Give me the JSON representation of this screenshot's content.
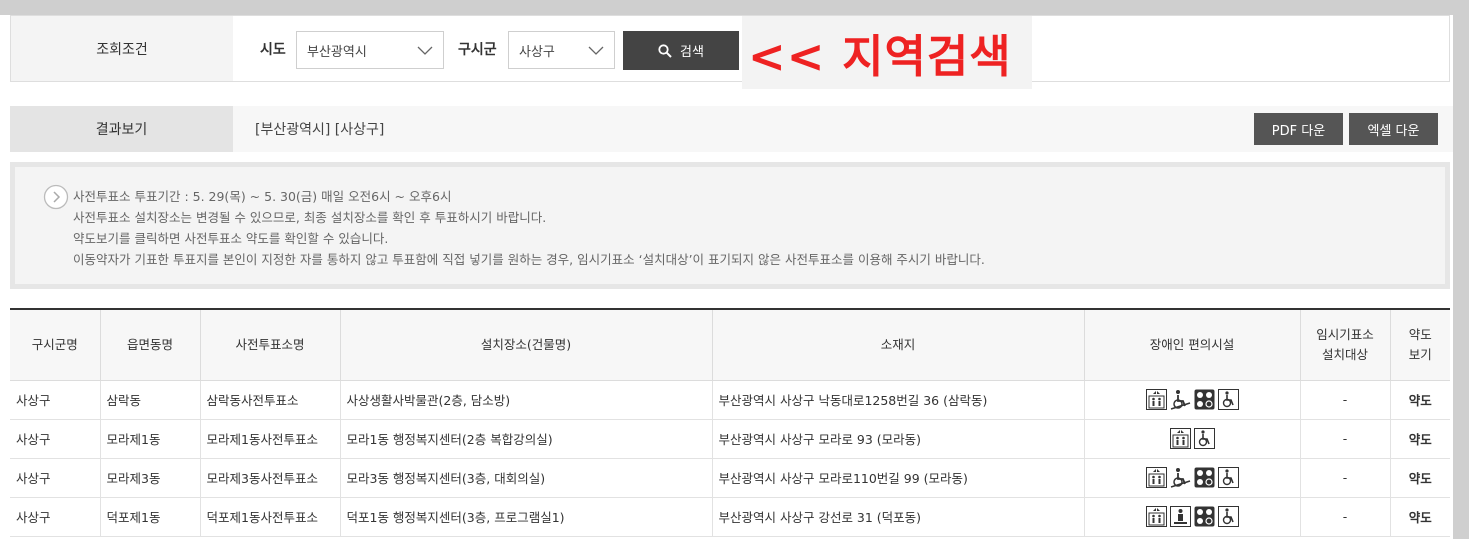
{
  "search": {
    "label": "조회조건",
    "sido_label": "시도",
    "sido_value": "부산광역시",
    "sigungu_label": "구시군",
    "sigungu_value": "사상구",
    "button_label": "검색",
    "annotation": "<< 지역검색"
  },
  "result": {
    "label": "결과보기",
    "text": "[부산광역시] [사상구]",
    "pdf_label": "PDF 다운",
    "excel_label": "엑셀 다운"
  },
  "notice": {
    "lines": [
      "사전투표소 투표기간 : 5. 29(목) ~ 5. 30(금) 매일 오전6시 ~ 오후6시",
      "사전투표소 설치장소는 변경될 수 있으므로, 최종 설치장소를 확인 후 투표하시기 바랍니다.",
      "약도보기를 클릭하면 사전투표소 약도를 확인할 수 있습니다.",
      "이동약자가 기표한 투표지를 본인이 지정한 자를 통하지 않고 투표함에 직접 넣기를 원하는 경우, 임시기표소 ‘설치대상’이 표기되지 않은 사전투표소를 이용해 주시기 바랍니다."
    ]
  },
  "table": {
    "headers": [
      "구시군명",
      "읍면동명",
      "사전투표소명",
      "설치장소(건물명)",
      "소재지",
      "장애인 편의시설",
      "임시기표소\n설치대상",
      "약도\n보기"
    ],
    "rows": [
      {
        "gu": "사상구",
        "dong": "삼락동",
        "name": "삼락동사전투표소",
        "place": "사상생활사박물관(2층, 담소방)",
        "addr": "부산광역시 사상구 낙동대로1258번길 36 (삼락동)",
        "facilities": [
          "elevator-icon",
          "wheelchair-ramp-icon",
          "braille-icon",
          "wheelchair-icon"
        ],
        "temp": "-",
        "map": "약도"
      },
      {
        "gu": "사상구",
        "dong": "모라제1동",
        "name": "모라제1동사전투표소",
        "place": "모라1동 행정복지센터(2층 복합강의실)",
        "addr": "부산광역시 사상구 모라로 93 (모라동)",
        "facilities": [
          "elevator-icon",
          "wheelchair-icon"
        ],
        "temp": "-",
        "map": "약도"
      },
      {
        "gu": "사상구",
        "dong": "모라제3동",
        "name": "모라제3동사전투표소",
        "place": "모라3동 행정복지센터(3층, 대회의실)",
        "addr": "부산광역시 사상구 모라로110번길 99 (모라동)",
        "facilities": [
          "elevator-icon",
          "wheelchair-ramp-icon",
          "braille-icon",
          "wheelchair-icon"
        ],
        "temp": "-",
        "map": "약도"
      },
      {
        "gu": "사상구",
        "dong": "덕포제1동",
        "name": "덕포제1동사전투표소",
        "place": "덕포1동 행정복지센터(3층, 프로그램실1)",
        "addr": "부산광역시 사상구 강선로 31 (덕포동)",
        "facilities": [
          "elevator-icon",
          "lift-icon",
          "braille-icon",
          "wheelchair-icon"
        ],
        "temp": "-",
        "map": "약도"
      }
    ]
  },
  "colors": {
    "button_dark": "#444444",
    "annotation_red": "#ee2222",
    "header_bg": "#f7f7f7"
  }
}
